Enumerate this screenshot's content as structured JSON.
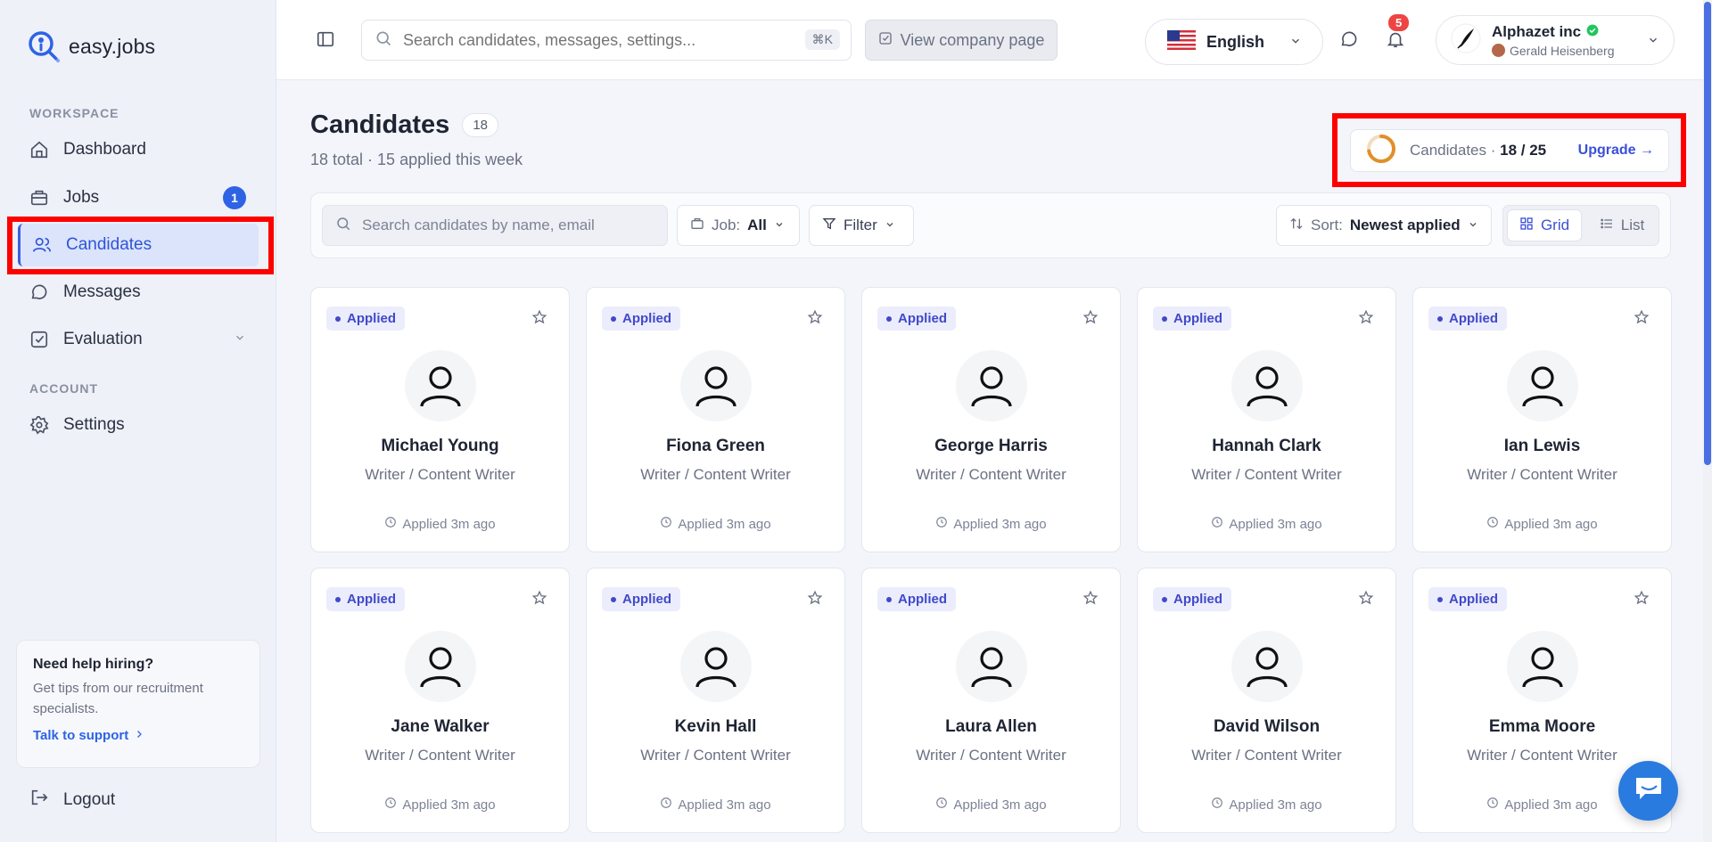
{
  "brand": {
    "name": "easy.jobs"
  },
  "sidebar": {
    "workspace_label": "WORKSPACE",
    "account_label": "ACCOUNT",
    "items": [
      {
        "label": "Dashboard",
        "icon": "home-icon"
      },
      {
        "label": "Jobs",
        "icon": "briefcase-icon",
        "badge": "1"
      },
      {
        "label": "Candidates",
        "icon": "users-icon",
        "active": true
      },
      {
        "label": "Messages",
        "icon": "message-icon"
      },
      {
        "label": "Evaluation",
        "icon": "checklist-icon"
      }
    ],
    "settings_label": "Settings",
    "help": {
      "title": "Need help hiring?",
      "text": "Get tips from our recruitment specialists.",
      "link": "Talk to support"
    },
    "logout_label": "Logout"
  },
  "header": {
    "search_placeholder": "Search candidates, messages, settings...",
    "search_shortcut": "⌘K",
    "view_company_label": "View company page",
    "language": "English",
    "notification_count": "5",
    "account": {
      "company": "Alphazet inc",
      "user": "Gerald Heisenberg"
    }
  },
  "page": {
    "title": "Candidates",
    "count": "18",
    "subtitle": "18 total · 15 applied this week",
    "quota": {
      "label": "Candidates ·",
      "value": "18 / 25",
      "used_fraction": 0.72,
      "upgrade_label": "Upgrade →"
    }
  },
  "toolbar": {
    "search_placeholder": "Search candidates by name, email",
    "job_label": "Job:",
    "job_value": "All",
    "filter_label": "Filter",
    "sort_label": "Sort:",
    "sort_value": "Newest applied",
    "grid_label": "Grid",
    "list_label": "List"
  },
  "candidates": [
    {
      "name": "Michael Young",
      "role": "Writer / Content Writer",
      "status": "Applied",
      "applied": "Applied 3m ago"
    },
    {
      "name": "Fiona Green",
      "role": "Writer / Content Writer",
      "status": "Applied",
      "applied": "Applied 3m ago"
    },
    {
      "name": "George Harris",
      "role": "Writer / Content Writer",
      "status": "Applied",
      "applied": "Applied 3m ago"
    },
    {
      "name": "Hannah Clark",
      "role": "Writer / Content Writer",
      "status": "Applied",
      "applied": "Applied 3m ago"
    },
    {
      "name": "Ian Lewis",
      "role": "Writer / Content Writer",
      "status": "Applied",
      "applied": "Applied 3m ago"
    },
    {
      "name": "Jane Walker",
      "role": "Writer / Content Writer",
      "status": "Applied",
      "applied": "Applied 3m ago"
    },
    {
      "name": "Kevin Hall",
      "role": "Writer / Content Writer",
      "status": "Applied",
      "applied": "Applied 3m ago"
    },
    {
      "name": "Laura Allen",
      "role": "Writer / Content Writer",
      "status": "Applied",
      "applied": "Applied 3m ago"
    },
    {
      "name": "David Wilson",
      "role": "Writer / Content Writer",
      "status": "Applied",
      "applied": "Applied 3m ago"
    },
    {
      "name": "Emma Moore",
      "role": "Writer / Content Writer",
      "status": "Applied",
      "applied": "Applied 3m ago"
    }
  ],
  "colors": {
    "accent": "#2e63e6",
    "highlight": "#ff0000",
    "quota_ring": "#e0902a"
  }
}
